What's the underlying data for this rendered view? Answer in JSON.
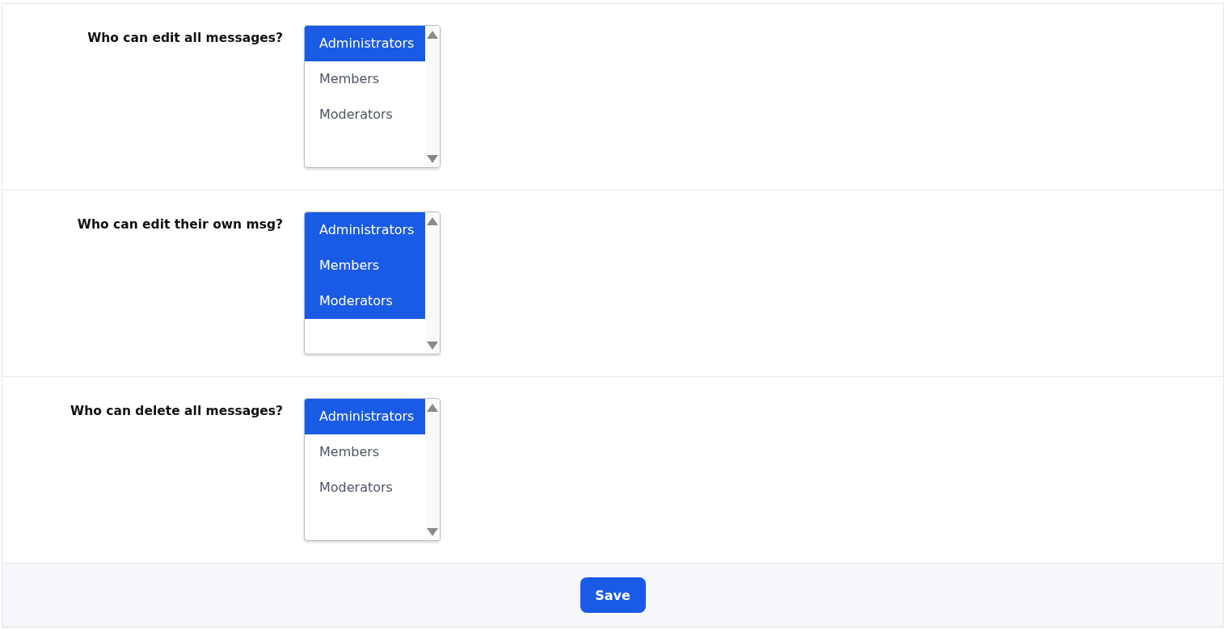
{
  "fields": [
    {
      "label": "Who can edit all messages?",
      "options": [
        {
          "label": "Administrators",
          "selected": true
        },
        {
          "label": "Members",
          "selected": false
        },
        {
          "label": "Moderators",
          "selected": false
        }
      ]
    },
    {
      "label": "Who can edit their own msg?",
      "options": [
        {
          "label": "Administrators",
          "selected": true
        },
        {
          "label": "Members",
          "selected": true
        },
        {
          "label": "Moderators",
          "selected": true
        }
      ]
    },
    {
      "label": "Who can delete all messages?",
      "options": [
        {
          "label": "Administrators",
          "selected": true
        },
        {
          "label": "Members",
          "selected": false
        },
        {
          "label": "Moderators",
          "selected": false
        }
      ]
    }
  ],
  "save_button": "Save"
}
